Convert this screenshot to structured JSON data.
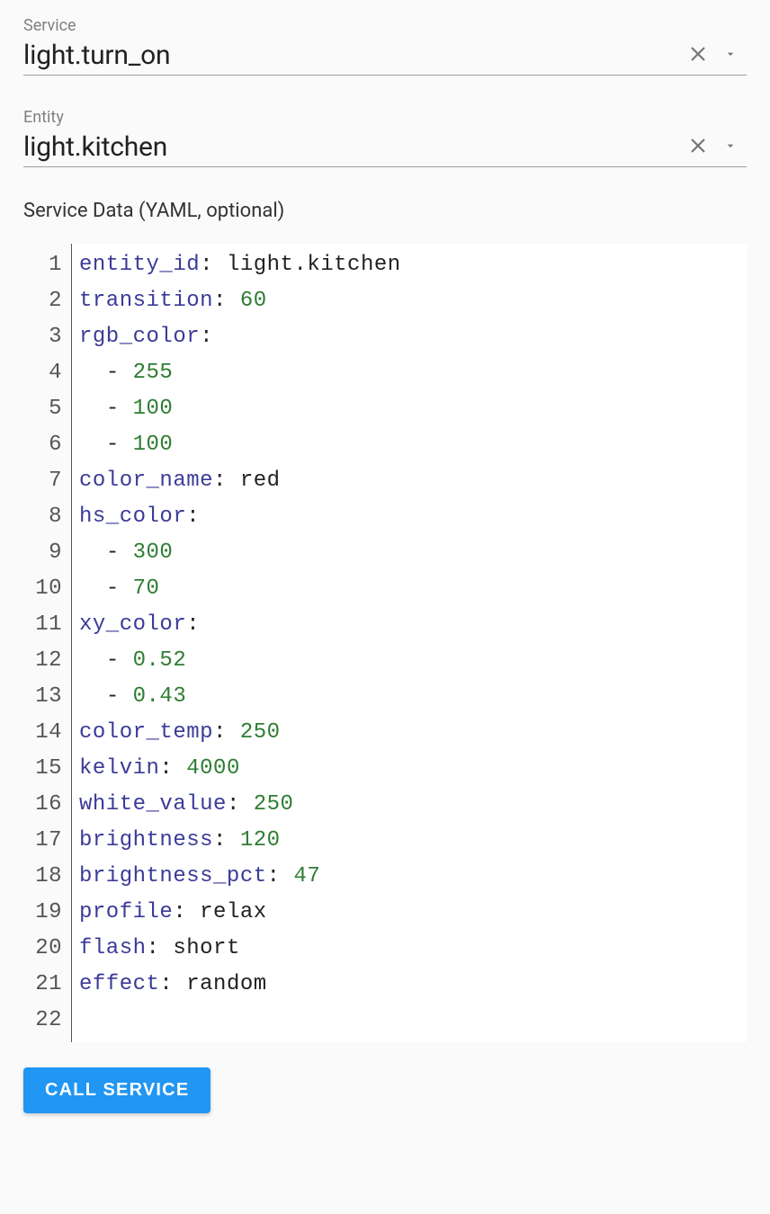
{
  "fields": {
    "service": {
      "label": "Service",
      "value": "light.turn_on"
    },
    "entity": {
      "label": "Entity",
      "value": "light.kitchen"
    }
  },
  "section_label": "Service Data (YAML, optional)",
  "yaml_lines": [
    [
      {
        "t": "key",
        "v": "entity_id"
      },
      {
        "t": "punc",
        "v": ":"
      },
      {
        "t": "sp",
        "v": " "
      },
      {
        "t": "val",
        "v": "light.kitchen"
      }
    ],
    [
      {
        "t": "key",
        "v": "transition"
      },
      {
        "t": "punc",
        "v": ":"
      },
      {
        "t": "sp",
        "v": " "
      },
      {
        "t": "num",
        "v": "60"
      }
    ],
    [
      {
        "t": "key",
        "v": "rgb_color"
      },
      {
        "t": "punc",
        "v": ":"
      }
    ],
    [
      {
        "t": "sp",
        "v": "  "
      },
      {
        "t": "dash",
        "v": "- "
      },
      {
        "t": "num",
        "v": "255"
      }
    ],
    [
      {
        "t": "sp",
        "v": "  "
      },
      {
        "t": "dash",
        "v": "- "
      },
      {
        "t": "num",
        "v": "100"
      }
    ],
    [
      {
        "t": "sp",
        "v": "  "
      },
      {
        "t": "dash",
        "v": "- "
      },
      {
        "t": "num",
        "v": "100"
      }
    ],
    [
      {
        "t": "key",
        "v": "color_name"
      },
      {
        "t": "punc",
        "v": ":"
      },
      {
        "t": "sp",
        "v": " "
      },
      {
        "t": "val",
        "v": "red"
      }
    ],
    [
      {
        "t": "key",
        "v": "hs_color"
      },
      {
        "t": "punc",
        "v": ":"
      }
    ],
    [
      {
        "t": "sp",
        "v": "  "
      },
      {
        "t": "dash",
        "v": "- "
      },
      {
        "t": "num",
        "v": "300"
      }
    ],
    [
      {
        "t": "sp",
        "v": "  "
      },
      {
        "t": "dash",
        "v": "- "
      },
      {
        "t": "num",
        "v": "70"
      }
    ],
    [
      {
        "t": "key",
        "v": "xy_color"
      },
      {
        "t": "punc",
        "v": ":"
      }
    ],
    [
      {
        "t": "sp",
        "v": "  "
      },
      {
        "t": "dash",
        "v": "- "
      },
      {
        "t": "num",
        "v": "0.52"
      }
    ],
    [
      {
        "t": "sp",
        "v": "  "
      },
      {
        "t": "dash",
        "v": "- "
      },
      {
        "t": "num",
        "v": "0.43"
      }
    ],
    [
      {
        "t": "key",
        "v": "color_temp"
      },
      {
        "t": "punc",
        "v": ":"
      },
      {
        "t": "sp",
        "v": " "
      },
      {
        "t": "num",
        "v": "250"
      }
    ],
    [
      {
        "t": "key",
        "v": "kelvin"
      },
      {
        "t": "punc",
        "v": ":"
      },
      {
        "t": "sp",
        "v": " "
      },
      {
        "t": "num",
        "v": "4000"
      }
    ],
    [
      {
        "t": "key",
        "v": "white_value"
      },
      {
        "t": "punc",
        "v": ":"
      },
      {
        "t": "sp",
        "v": " "
      },
      {
        "t": "num",
        "v": "250"
      }
    ],
    [
      {
        "t": "key",
        "v": "brightness"
      },
      {
        "t": "punc",
        "v": ":"
      },
      {
        "t": "sp",
        "v": " "
      },
      {
        "t": "num",
        "v": "120"
      }
    ],
    [
      {
        "t": "key",
        "v": "brightness_pct"
      },
      {
        "t": "punc",
        "v": ":"
      },
      {
        "t": "sp",
        "v": " "
      },
      {
        "t": "num",
        "v": "47"
      }
    ],
    [
      {
        "t": "key",
        "v": "profile"
      },
      {
        "t": "punc",
        "v": ":"
      },
      {
        "t": "sp",
        "v": " "
      },
      {
        "t": "val",
        "v": "relax"
      }
    ],
    [
      {
        "t": "key",
        "v": "flash"
      },
      {
        "t": "punc",
        "v": ":"
      },
      {
        "t": "sp",
        "v": " "
      },
      {
        "t": "val",
        "v": "short"
      }
    ],
    [
      {
        "t": "key",
        "v": "effect"
      },
      {
        "t": "punc",
        "v": ":"
      },
      {
        "t": "sp",
        "v": " "
      },
      {
        "t": "val",
        "v": "random"
      }
    ],
    []
  ],
  "button": {
    "call_service": "CALL SERVICE"
  }
}
